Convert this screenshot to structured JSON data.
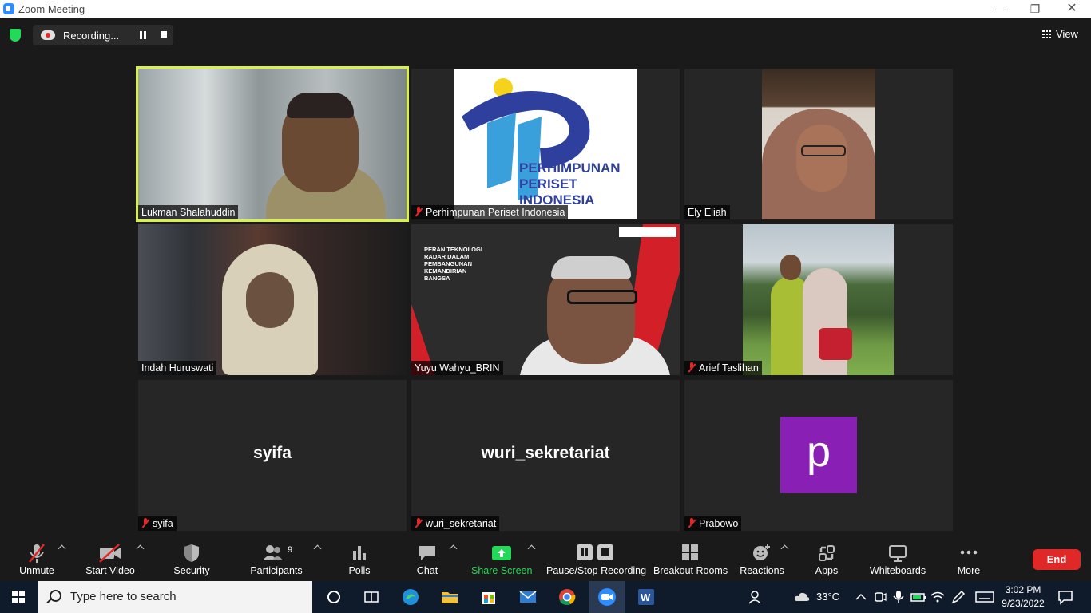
{
  "window": {
    "title": "Zoom Meeting"
  },
  "topbar": {
    "recording_label": "Recording...",
    "view_label": "View"
  },
  "tiles": [
    {
      "name": "Lukman Shalahuddin",
      "muted": false,
      "active": true,
      "kind": "video"
    },
    {
      "name": "Perhimpunan Periset Indonesia",
      "muted": true,
      "kind": "logo",
      "logo_text": [
        "PERHIMPUNAN",
        "PERISET",
        "INDONESIA"
      ]
    },
    {
      "name": "Ely Eliah",
      "muted": false,
      "kind": "video"
    },
    {
      "name": "Indah Huruswati",
      "muted": false,
      "kind": "video"
    },
    {
      "name": "Yuyu Wahyu_BRIN",
      "muted": false,
      "kind": "video",
      "slide_text": [
        "PERAN TEKNOLOGI",
        "RADAR DALAM",
        "PEMBANGUNAN",
        "KEMANDIRIAN",
        "BANGSA"
      ]
    },
    {
      "name": "Arief Taslihan",
      "muted": true,
      "kind": "video"
    },
    {
      "name": "syifa",
      "muted": true,
      "kind": "name",
      "display": "syifa"
    },
    {
      "name": "wuri_sekretariat",
      "muted": true,
      "kind": "name",
      "display": "wuri_sekretariat"
    },
    {
      "name": "Prabowo",
      "muted": true,
      "kind": "avatar",
      "display": "p",
      "avatar_color": "#8a1fb5"
    }
  ],
  "toolbar": {
    "unmute": "Unmute",
    "start_video": "Start Video",
    "security": "Security",
    "participants": "Participants",
    "participants_count": "9",
    "polls": "Polls",
    "chat": "Chat",
    "share_screen": "Share Screen",
    "recording": "Pause/Stop Recording",
    "breakout": "Breakout Rooms",
    "reactions": "Reactions",
    "apps": "Apps",
    "whiteboards": "Whiteboards",
    "more": "More",
    "end": "End"
  },
  "taskbar": {
    "search_placeholder": "Type here to search",
    "temperature": "33°C",
    "time": "3:02 PM",
    "date": "9/23/2022"
  },
  "colors": {
    "share_green": "#23d959",
    "end_red": "#e02828",
    "active_speaker": "#d9f04a"
  }
}
